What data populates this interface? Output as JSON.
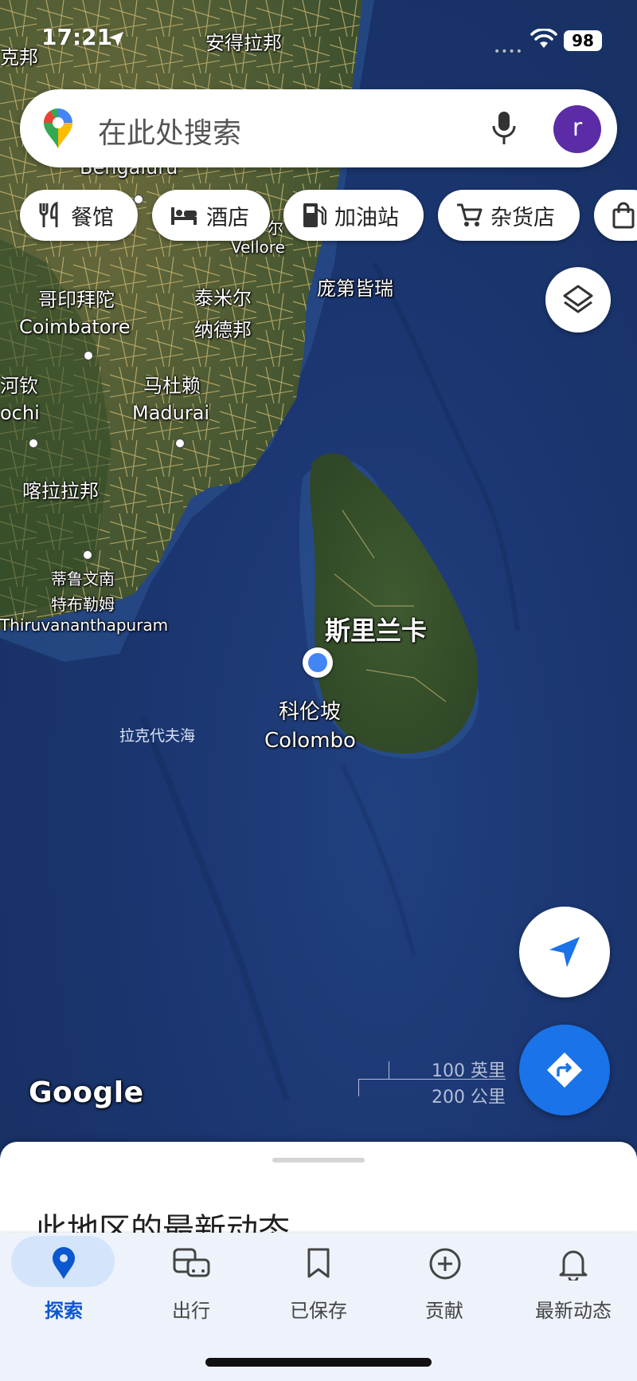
{
  "status_bar": {
    "time": "17:21",
    "battery": "98"
  },
  "search": {
    "placeholder": "在此处搜索",
    "avatar_letter": "r"
  },
  "chips": [
    {
      "label": "餐馆",
      "icon": "restaurant-icon"
    },
    {
      "label": "酒店",
      "icon": "hotel-icon"
    },
    {
      "label": "加油站",
      "icon": "gas-station-icon"
    },
    {
      "label": "杂货店",
      "icon": "grocery-cart-icon"
    },
    {
      "label": "",
      "icon": "shopping-bag-icon"
    }
  ],
  "map": {
    "labels": {
      "andhra": "安得拉邦",
      "karnataka_partial": "克邦",
      "bengaluru": "Bengaluru",
      "vellore": "Vellore",
      "vellore_cn": "尔",
      "pondicherry": "庞第皆瑞",
      "coimbatore_cn": "哥印拜陀",
      "coimbatore": "Coimbatore",
      "tamil_nadu_cn_1": "泰米尔",
      "tamil_nadu_cn_2": "纳德邦",
      "kochi_cn": "河钦",
      "kochi": "ochi",
      "madurai_cn": "马杜赖",
      "madurai": "Madurai",
      "kerala": "喀拉拉邦",
      "tvm_cn_1": "蒂鲁文南",
      "tvm_cn_2": "特布勒姆",
      "tvm": "Thiruvananthapuram",
      "sri_lanka": "斯里兰卡",
      "colombo_cn": "科伦坡",
      "colombo": "Colombo",
      "laccadive_sea": "拉克代夫海"
    },
    "attribution": "Google",
    "scale": {
      "imperial": "100 英里",
      "metric": "200 公里"
    }
  },
  "sheet": {
    "title": "此地区的最新动态"
  },
  "nav": [
    {
      "label": "探索",
      "icon": "explore-pin-icon",
      "active": true
    },
    {
      "label": "出行",
      "icon": "commute-icon",
      "active": false
    },
    {
      "label": "已保存",
      "icon": "bookmark-icon",
      "active": false
    },
    {
      "label": "贡献",
      "icon": "add-circle-icon",
      "active": false
    },
    {
      "label": "最新动态",
      "icon": "bell-icon",
      "active": false
    }
  ],
  "colors": {
    "accent": "#1a73e8",
    "active_nav": "#0b57d0",
    "avatar": "#5b2ca6",
    "ocean": "#1b3570"
  }
}
